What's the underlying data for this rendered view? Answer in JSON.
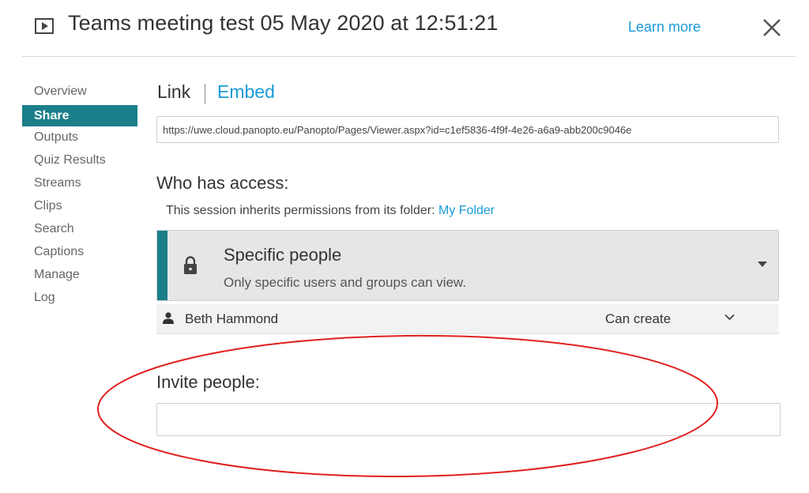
{
  "header": {
    "title": "Teams meeting test 05 May 2020 at 12:51:21",
    "learn_more": "Learn more",
    "play_icon": "play-box-icon",
    "close_icon": "close-icon"
  },
  "sidebar": {
    "items": [
      {
        "label": "Overview",
        "active": false
      },
      {
        "label": "Share",
        "active": true
      },
      {
        "label": "Outputs",
        "active": false
      },
      {
        "label": "Quiz Results",
        "active": false
      },
      {
        "label": "Streams",
        "active": false
      },
      {
        "label": "Clips",
        "active": false
      },
      {
        "label": "Search",
        "active": false
      },
      {
        "label": "Captions",
        "active": false
      },
      {
        "label": "Manage",
        "active": false
      },
      {
        "label": "Log",
        "active": false
      }
    ]
  },
  "share": {
    "tabs": {
      "link": "Link",
      "embed": "Embed"
    },
    "url": "https://uwe.cloud.panopto.eu/Panopto/Pages/Viewer.aspx?id=c1ef5836-4f9f-4e26-a6a9-abb200c9046e",
    "access_heading": "Who has access:",
    "inherit_text": "This session inherits permissions from its folder: ",
    "folder_link": "My Folder",
    "access_option": {
      "title": "Specific people",
      "description": "Only specific users and groups can view.",
      "icon": "lock-icon"
    },
    "users": [
      {
        "name": "Beth Hammond",
        "role": "Can create",
        "icon": "person-icon"
      }
    ],
    "invite_label": "Invite people:",
    "invite_value": "",
    "invite_placeholder": ""
  },
  "colors": {
    "accent": "#1b7f8a",
    "link": "#1a9bd7",
    "annotation": "#e0201e"
  }
}
